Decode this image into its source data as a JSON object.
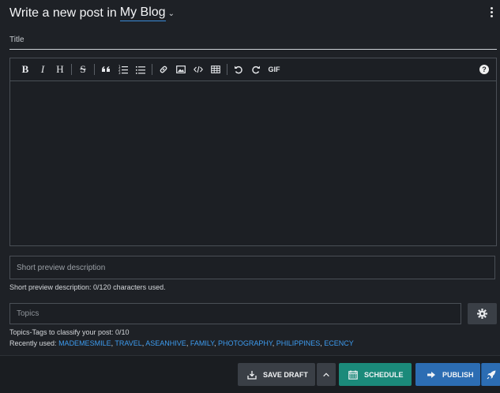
{
  "header": {
    "prefix": "Write a new post in",
    "blog": "My Blog"
  },
  "title_field": {
    "placeholder": "Title",
    "value": ""
  },
  "toolbar": {
    "buttons": [
      {
        "name": "bold",
        "glyph": "B"
      },
      {
        "name": "italic",
        "glyph": "I"
      },
      {
        "name": "heading",
        "glyph": "H"
      },
      {
        "name": "strikethrough",
        "glyph": "S"
      },
      {
        "name": "quote",
        "glyph": "❝"
      },
      {
        "name": "ordered-list",
        "glyph": "1≡"
      },
      {
        "name": "unordered-list",
        "glyph": "≡"
      },
      {
        "name": "link",
        "glyph": "link"
      },
      {
        "name": "image",
        "glyph": "img"
      },
      {
        "name": "code",
        "glyph": "</>"
      },
      {
        "name": "table",
        "glyph": "tbl"
      },
      {
        "name": "undo",
        "glyph": "↺"
      },
      {
        "name": "redo",
        "glyph": "↻"
      },
      {
        "name": "gif",
        "glyph": "GIF"
      }
    ],
    "help": "?"
  },
  "description_field": {
    "placeholder": "Short preview description",
    "value": "",
    "hint": "Short preview description: 0/120 characters used."
  },
  "topics_field": {
    "placeholder": "Topics",
    "value": "",
    "hint": "Topics-Tags to classify your post: 0/10",
    "recent_label": "Recently used:",
    "recent_tags": [
      "MADEMESMILE",
      "TRAVEL",
      "ASEANHIVE",
      "FAMILY",
      "PHOTOGRAPHY",
      "PHILIPPINES",
      "ECENCY"
    ]
  },
  "footer": {
    "save_draft": "SAVE DRAFT",
    "schedule": "SCHEDULE",
    "publish": "PUBLISH"
  },
  "colors": {
    "background": "#1e2126",
    "accent_link": "#3d9cf0",
    "schedule": "#1b8a7a",
    "publish": "#2c6db3",
    "neutral_button": "#3a3f46"
  }
}
